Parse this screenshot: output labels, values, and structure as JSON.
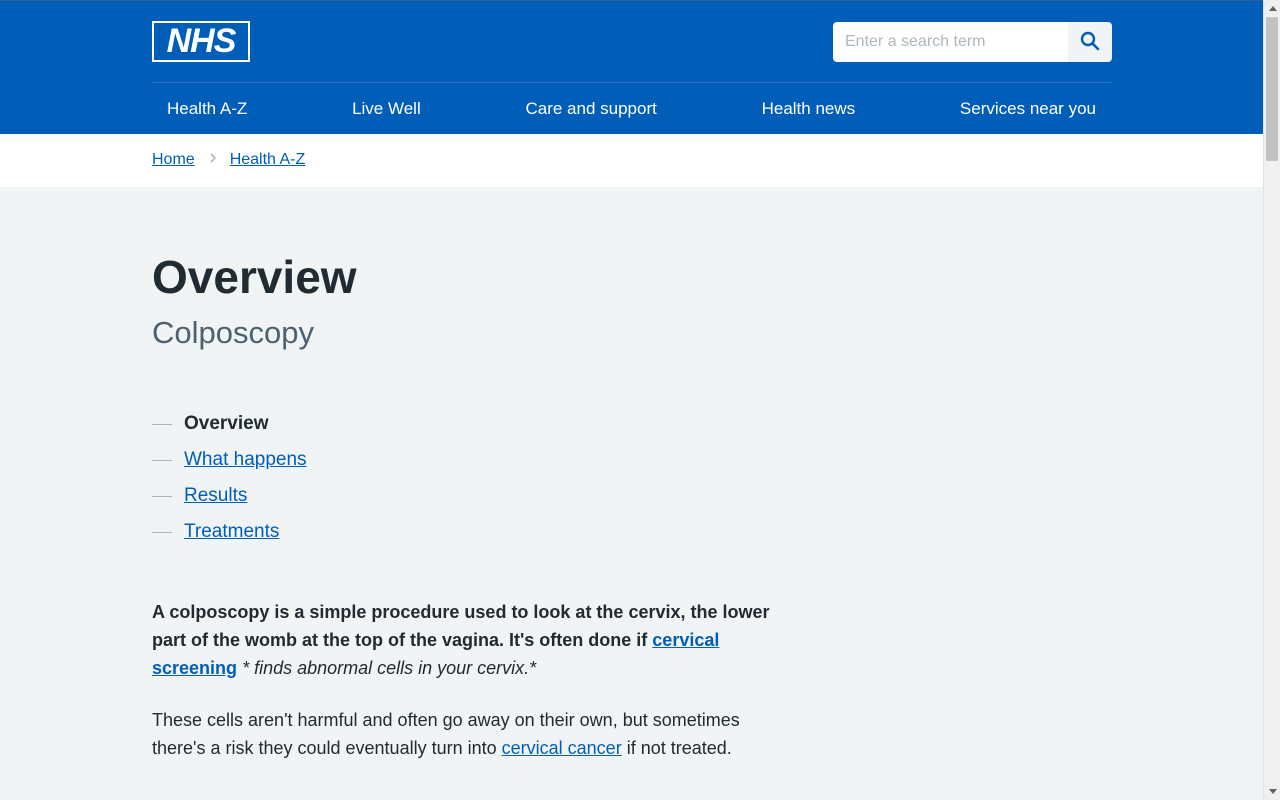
{
  "header": {
    "logo_text": "NHS",
    "search": {
      "placeholder": "Enter a search term",
      "value": ""
    },
    "nav": [
      {
        "label": "Health A-Z"
      },
      {
        "label": "Live Well"
      },
      {
        "label": "Care and support"
      },
      {
        "label": "Health news"
      },
      {
        "label": "Services near you"
      }
    ]
  },
  "breadcrumb": [
    {
      "label": "Home"
    },
    {
      "label": "Health A-Z"
    }
  ],
  "page": {
    "title": "Overview",
    "subtitle": "Colposcopy",
    "contents": [
      {
        "label": "Overview",
        "current": true
      },
      {
        "label": "What happens",
        "current": false
      },
      {
        "label": "Results",
        "current": false
      },
      {
        "label": "Treatments",
        "current": false
      }
    ],
    "lede": {
      "bold_text": "A colposcopy is a simple procedure used to look at the cervix, the lower part of the womb at the top of the vagina. It's often done if",
      "link": "cervical screening",
      "italic_text": "* finds abnormal cells in your cervix.*"
    },
    "paragraph": {
      "text": "These cells aren't harmful and often go away on their own, but sometimes there's a risk they could eventually turn into",
      "link": "cervical cancer",
      "tail": "if not treated."
    }
  },
  "colors": {
    "nhs_blue": "#005eb8",
    "page_background": "#f0f4f5",
    "text": "#212b32",
    "secondary_text": "#4c6272"
  }
}
